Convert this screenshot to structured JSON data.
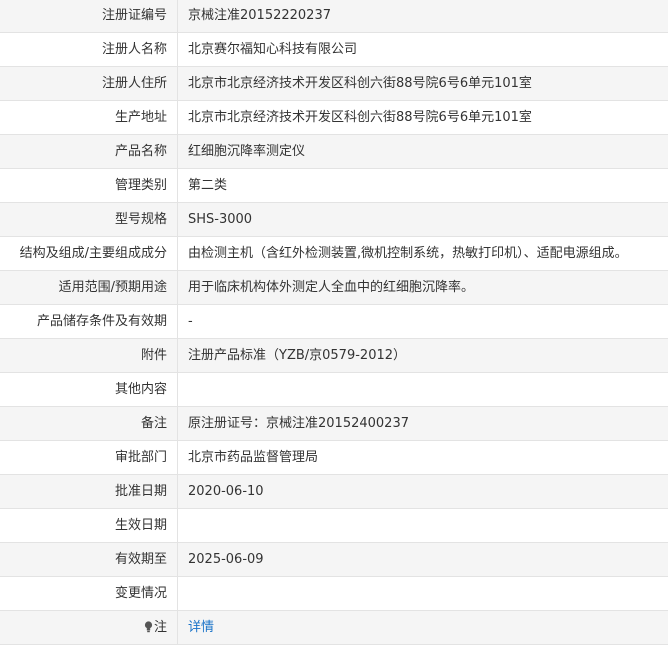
{
  "rows": [
    {
      "label": "注册证编号",
      "value": "京械注准20152220237"
    },
    {
      "label": "注册人名称",
      "value": "北京赛尔福知心科技有限公司"
    },
    {
      "label": "注册人住所",
      "value": "北京市北京经济技术开发区科创六街88号院6号6单元101室"
    },
    {
      "label": "生产地址",
      "value": "北京市北京经济技术开发区科创六街88号院6号6单元101室"
    },
    {
      "label": "产品名称",
      "value": "红细胞沉降率测定仪"
    },
    {
      "label": "管理类别",
      "value": "第二类"
    },
    {
      "label": "型号规格",
      "value": "SHS-3000"
    },
    {
      "label": "结构及组成/主要组成成分",
      "value": "由检测主机（含红外检测装置,微机控制系统，热敏打印机）、适配电源组成。"
    },
    {
      "label": "适用范围/预期用途",
      "value": "用于临床机构体外测定人全血中的红细胞沉降率。"
    },
    {
      "label": "产品储存条件及有效期",
      "value": "-"
    },
    {
      "label": "附件",
      "value": "注册产品标准（YZB/京0579-2012）"
    },
    {
      "label": "其他内容",
      "value": ""
    },
    {
      "label": "备注",
      "value": "原注册证号：京械注准20152400237"
    },
    {
      "label": "审批部门",
      "value": "北京市药品监督管理局"
    },
    {
      "label": "批准日期",
      "value": "2020-06-10"
    },
    {
      "label": "生效日期",
      "value": ""
    },
    {
      "label": "有效期至",
      "value": "2025-06-09"
    },
    {
      "label": "变更情况",
      "value": ""
    }
  ],
  "note_row": {
    "label": "注",
    "icon": "bulb-icon",
    "link_text": "详情"
  },
  "colors": {
    "link": "#1a73c8",
    "row_alt": "#f5f5f5",
    "border": "#e3e3e3"
  }
}
